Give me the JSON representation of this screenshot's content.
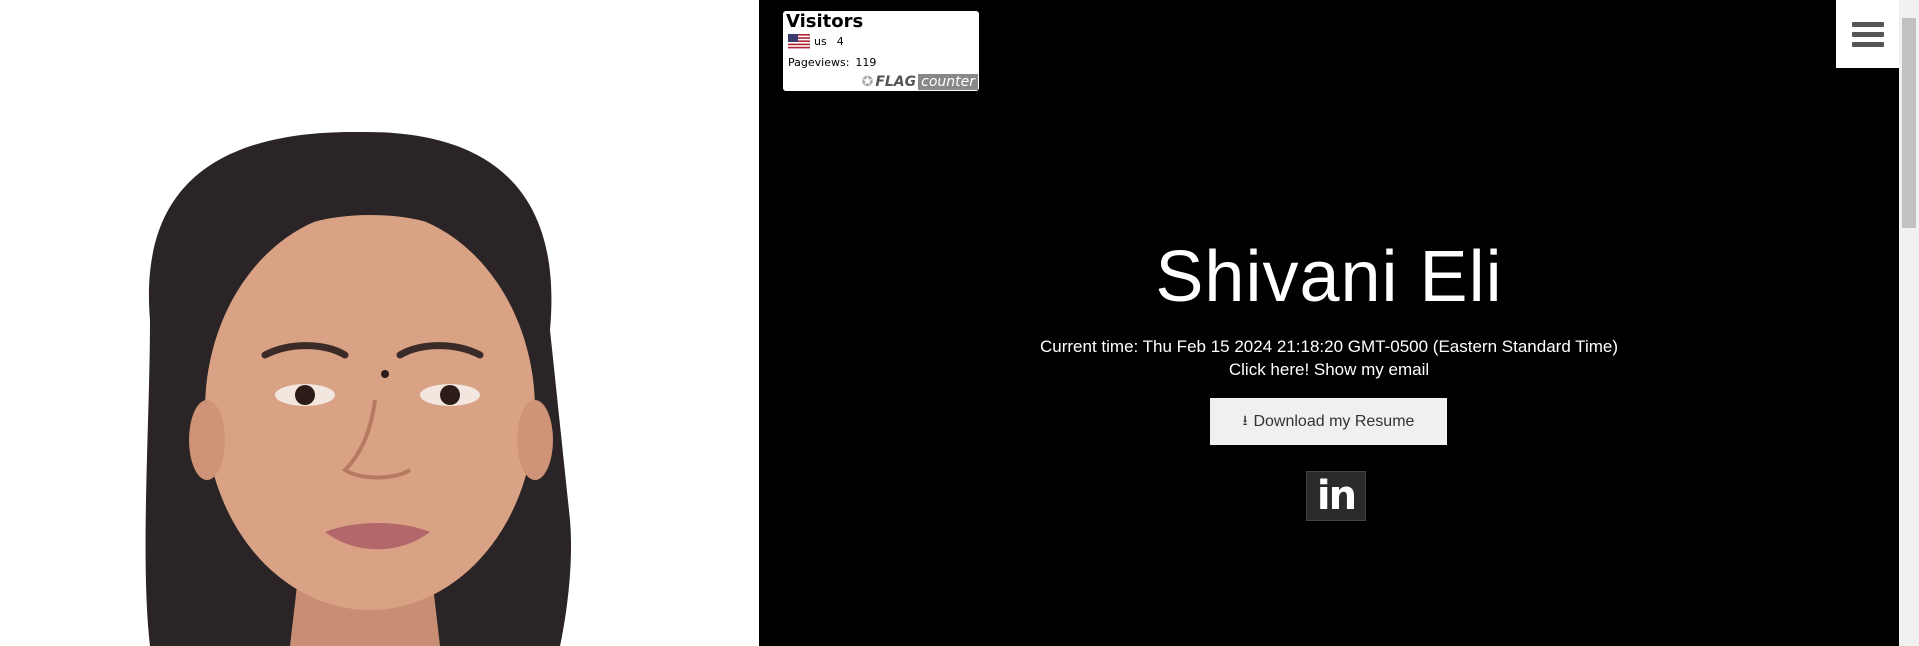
{
  "photo": {
    "alt": "Portrait photo of Shivani Eli",
    "icon": "portrait-photo"
  },
  "flag_counter": {
    "title": "Visitors",
    "country_code": "us",
    "country_count": "4",
    "pageviews_label": "Pageviews:",
    "pageviews_value": "119",
    "brand_flag": "FLAG",
    "brand_counter": "counter"
  },
  "hero": {
    "name": "Shivani Eli",
    "current_time": "Current time: Thu Feb 15 2024 21:18:20 GMT-0500 (Eastern Standard Time)",
    "email_link": "Click here! Show my email",
    "resume_button": "Download my Resume",
    "linkedin_label": "in"
  },
  "colors": {
    "hero_bg": "#000000",
    "button_bg": "#f0f0f0",
    "menu_bg": "#ffffff"
  },
  "icons": {
    "menu": "hamburger-icon",
    "download": "download-icon",
    "linkedin": "linkedin-icon",
    "flag": "us-flag-icon"
  }
}
